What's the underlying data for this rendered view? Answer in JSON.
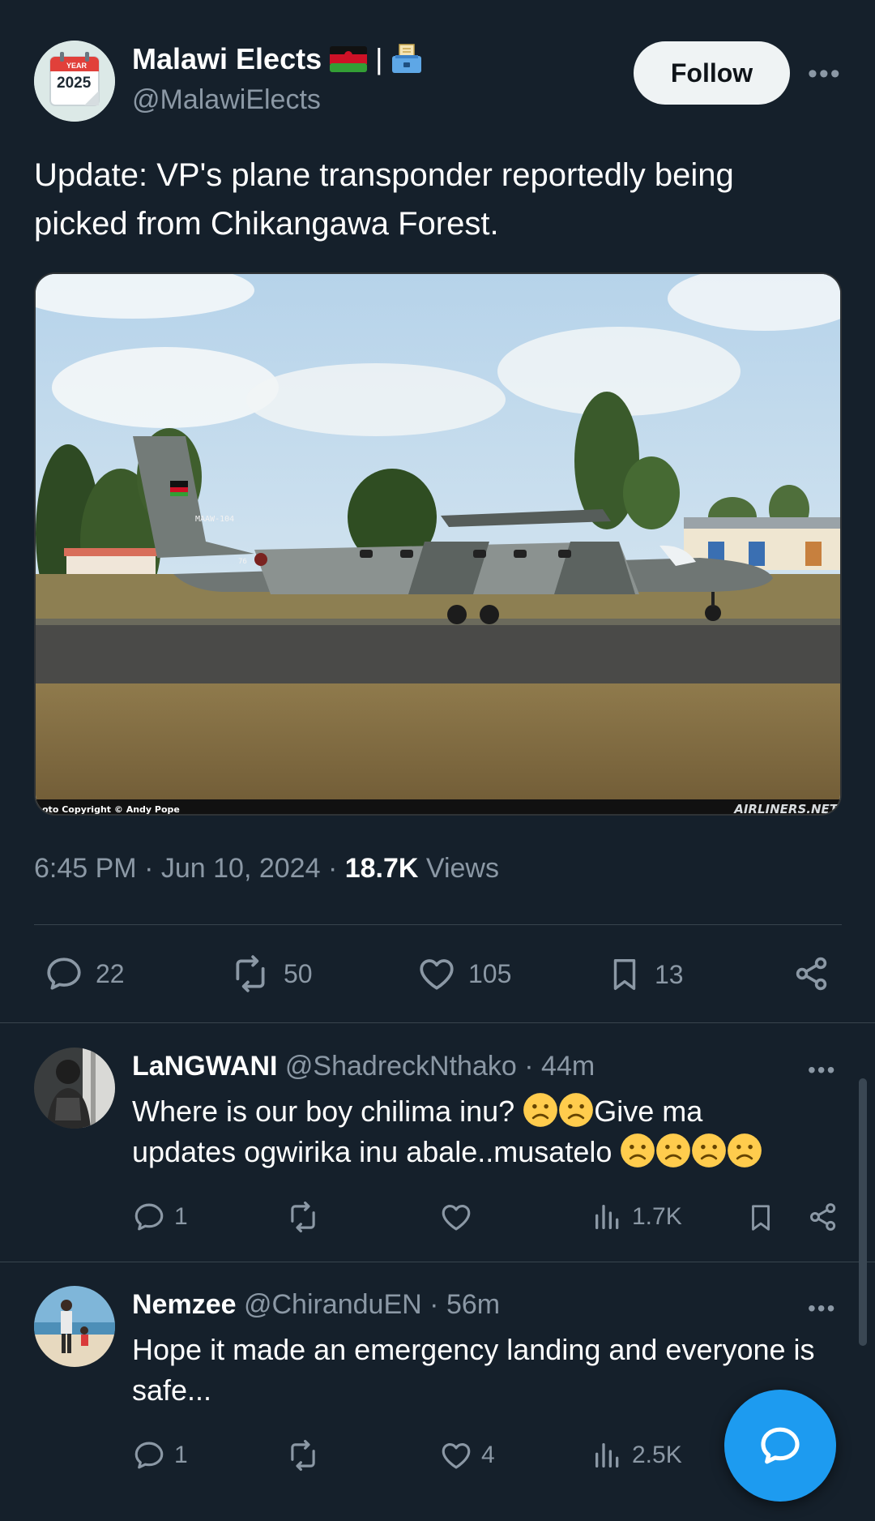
{
  "tweet": {
    "author_name": "Malawi Elects",
    "author_separator": "|",
    "author_handle": "@MalawiElects",
    "avatar_text_top": "YEAR",
    "avatar_text_year": "2025",
    "follow_label": "Follow",
    "text": "Update: VP's plane transponder reportedly being picked from Chikangawa Forest.",
    "image": {
      "tail_registration": "MAAW-104",
      "fuselage_text": "76",
      "credit_left": "oto Copyright © Andy Pope",
      "credit_right": "AIRLINERS.NET"
    },
    "time": "6:45 PM",
    "date": "Jun 10, 2024",
    "views_count": "18.7K",
    "views_label": "Views",
    "stats": {
      "replies": "22",
      "reposts": "50",
      "likes": "105",
      "bookmarks": "13"
    }
  },
  "replies": [
    {
      "name": "LaNGWANI",
      "handle": "@ShadreckNthako",
      "time": "44m",
      "text_line1": "Where is our boy chilima inu?",
      "text_line1b": "Give ma",
      "text_line2": "updates ogwirika inu abale..musatelo",
      "reply_count": "1",
      "repost_count": "",
      "like_count": "",
      "views": "1.7K"
    },
    {
      "name": "Nemzee",
      "handle": "@ChiranduEN",
      "time": "56m",
      "text": "Hope it made an emergency landing and everyone is safe...",
      "reply_count": "1",
      "repost_count": "",
      "like_count": "4",
      "views": "2.5K"
    }
  ],
  "colors": {
    "background": "#15202b",
    "muted": "#8b98a5",
    "accent": "#1d9bf0",
    "divider": "#38444d"
  },
  "icons": [
    "reply-icon",
    "repost-icon",
    "like-icon",
    "bookmark-icon",
    "share-icon",
    "views-icon",
    "more-icon",
    "compose-reply-icon"
  ]
}
